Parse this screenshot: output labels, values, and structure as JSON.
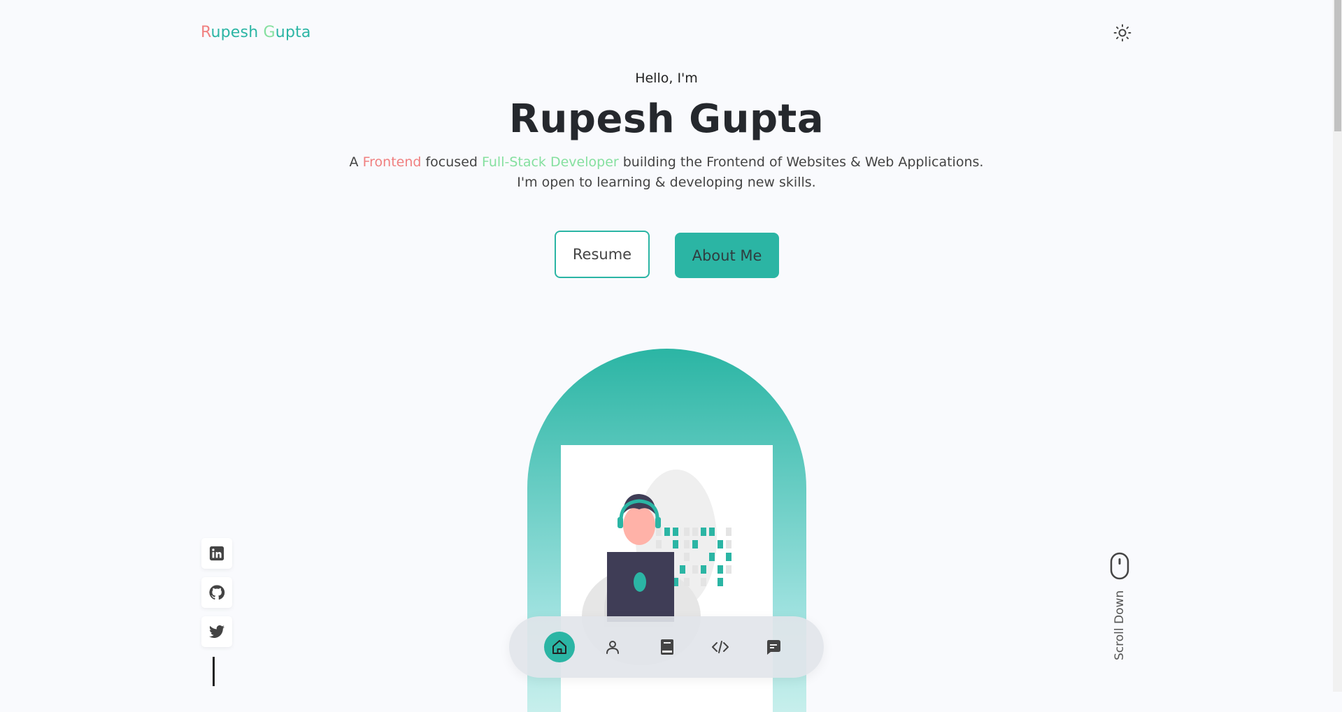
{
  "logo": {
    "initial1": "R",
    "rest1": "upesh ",
    "initial2": "G",
    "rest2": "upta"
  },
  "hero": {
    "greeting": "Hello, I'm",
    "name": "Rupesh Gupta",
    "desc_a": "A ",
    "desc_hl1": "Frontend",
    "desc_b": " focused ",
    "desc_hl2": "Full-Stack Developer",
    "desc_c": " building the Frontend of Websites & Web Applications.",
    "desc_line2": "I'm open to learning & developing new skills."
  },
  "buttons": {
    "resume": "Resume",
    "about": "About Me"
  },
  "scroll": {
    "label": "Scroll Down"
  },
  "icons": {
    "theme": "sun-icon",
    "socials": [
      "linkedin-icon",
      "github-icon",
      "twitter-icon"
    ],
    "nav": [
      "home-icon",
      "user-icon",
      "book-icon",
      "code-icon",
      "message-icon"
    ]
  },
  "colors": {
    "accent": "#2bb5a4",
    "highlight_red": "#f08080",
    "highlight_green": "#86e0a0",
    "background": "#f9fafd"
  }
}
